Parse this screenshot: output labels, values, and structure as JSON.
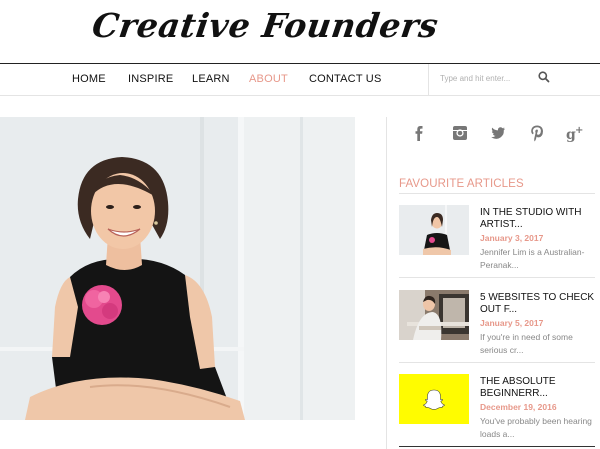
{
  "site": {
    "logo_text": "Creative Founders"
  },
  "nav": {
    "items": [
      {
        "label": "HOME"
      },
      {
        "label": "INSPIRE"
      },
      {
        "label": "LEARN"
      },
      {
        "label": "ABOUT",
        "active": true
      },
      {
        "label": "CONTACT US"
      }
    ],
    "search_placeholder": "Type and hit enter..."
  },
  "social": [
    "facebook-icon",
    "instagram-icon",
    "twitter-icon",
    "pinterest-icon",
    "google-plus-icon"
  ],
  "sidebar": {
    "section_title": "FAVOURITE ARTICLES",
    "articles": [
      {
        "title": "IN THE STUDIO WITH ARTIST...",
        "date": "January 3, 2017",
        "excerpt": "Jennifer Lim is a Australian-Peranak..."
      },
      {
        "title": "5 WEBSITES TO CHECK OUT F...",
        "date": "January 5, 2017",
        "excerpt": "If you're in need of some serious cr..."
      },
      {
        "title": "THE ABSOLUTE BEGINNERR...",
        "date": "December 19, 2016",
        "excerpt": "You've probably been hearing loads a..."
      }
    ]
  },
  "colors": {
    "accent": "#e7988a",
    "snapchat_yellow": "#fffc00"
  }
}
